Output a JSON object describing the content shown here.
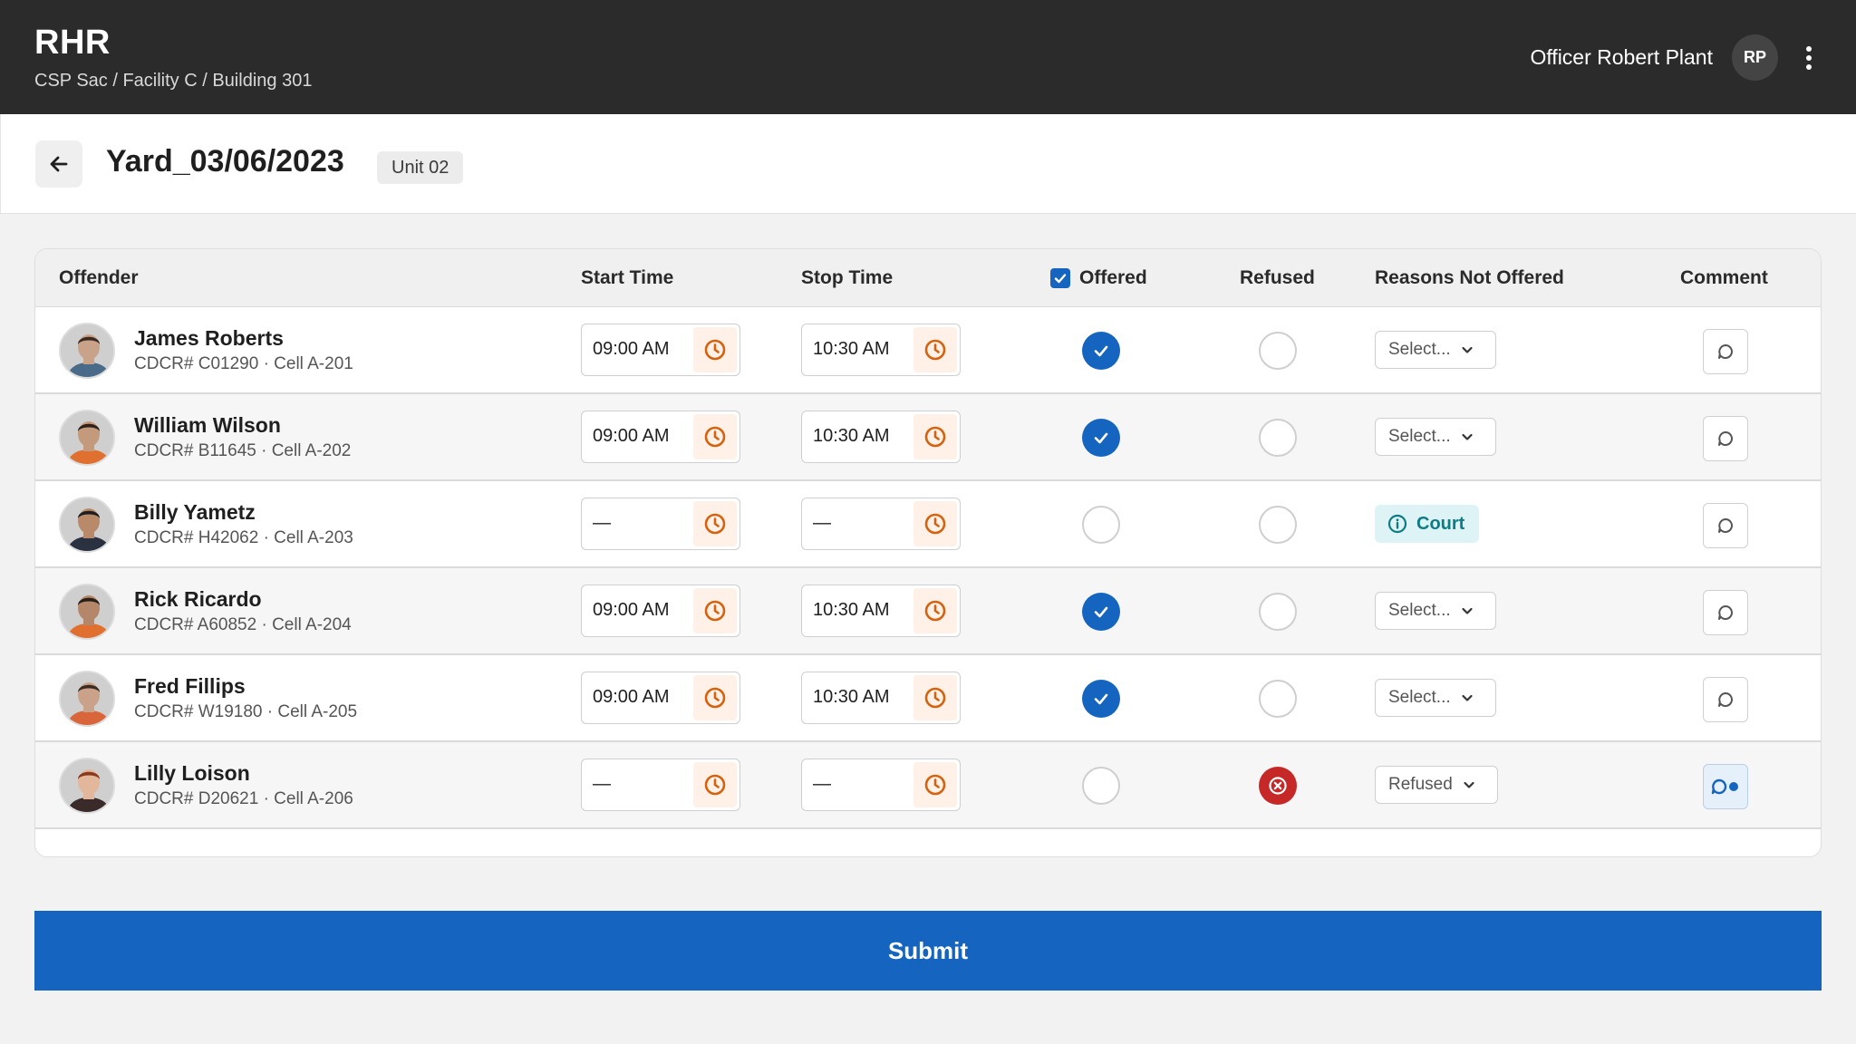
{
  "app": {
    "title": "RHR",
    "breadcrumb": "CSP Sac / Facility C / Building 301",
    "officer": "Officer Robert Plant",
    "officer_initials": "RP"
  },
  "page": {
    "title": "Yard_03/06/2023",
    "unit": "Unit 02"
  },
  "table": {
    "columns": {
      "offender": "Offender",
      "start": "Start Time",
      "stop": "Stop Time",
      "offered": "Offered",
      "refused": "Refused",
      "reasons": "Reasons Not Offered",
      "comment": "Comment"
    },
    "rows": [
      {
        "name": "James Roberts",
        "meta": "CDCR# C01290  ·  Cell A-201",
        "start": "09:00 AM",
        "stop": "10:30 AM",
        "offered": true,
        "refused": false,
        "reason": "Select...",
        "reason_style": "select",
        "has_comment": false,
        "skin": "#c8a38a",
        "hair": "#3a2a20",
        "shirt": "#4a6a8a"
      },
      {
        "name": "William Wilson",
        "meta": "CDCR# B11645  ·  Cell A-202",
        "start": "09:00 AM",
        "stop": "10:30 AM",
        "offered": true,
        "refused": false,
        "reason": "Select...",
        "reason_style": "select",
        "has_comment": false,
        "skin": "#c49a7c",
        "hair": "#2e221a",
        "shirt": "#e07030"
      },
      {
        "name": "Billy Yametz",
        "meta": "CDCR# H42062  ·  Cell A-203",
        "start": "—",
        "stop": "—",
        "offered": false,
        "refused": false,
        "reason": "Court",
        "reason_style": "court",
        "has_comment": false,
        "skin": "#b98a6a",
        "hair": "#1e1e1e",
        "shirt": "#2a3140"
      },
      {
        "name": "Rick Ricardo",
        "meta": "CDCR# A60852  ·  Cell A-204",
        "start": "09:00 AM",
        "stop": "10:30 AM",
        "offered": true,
        "refused": false,
        "reason": "Select...",
        "reason_style": "select",
        "has_comment": false,
        "skin": "#b4876a",
        "hair": "#2a1f18",
        "shirt": "#e0702f"
      },
      {
        "name": "Fred Fillips",
        "meta": "CDCR# W19180  ·  Cell A-205",
        "start": "09:00 AM",
        "stop": "10:30 AM",
        "offered": true,
        "refused": false,
        "reason": "Select...",
        "reason_style": "select",
        "has_comment": false,
        "skin": "#caa28a",
        "hair": "#3b2c22",
        "shirt": "#d9653a"
      },
      {
        "name": "Lilly Loison",
        "meta": "CDCR# D20621  ·  Cell A-206",
        "start": "—",
        "stop": "—",
        "offered": false,
        "refused": true,
        "reason": "Refused",
        "reason_style": "select",
        "has_comment": true,
        "skin": "#e2b79c",
        "hair": "#8a3a1c",
        "shirt": "#3a2a2a"
      }
    ]
  },
  "submit_label": "Submit",
  "colors": {
    "primary": "#1565c0",
    "danger": "#c62828",
    "clock_accent": "#d4620f",
    "court": "#0e7c86"
  }
}
